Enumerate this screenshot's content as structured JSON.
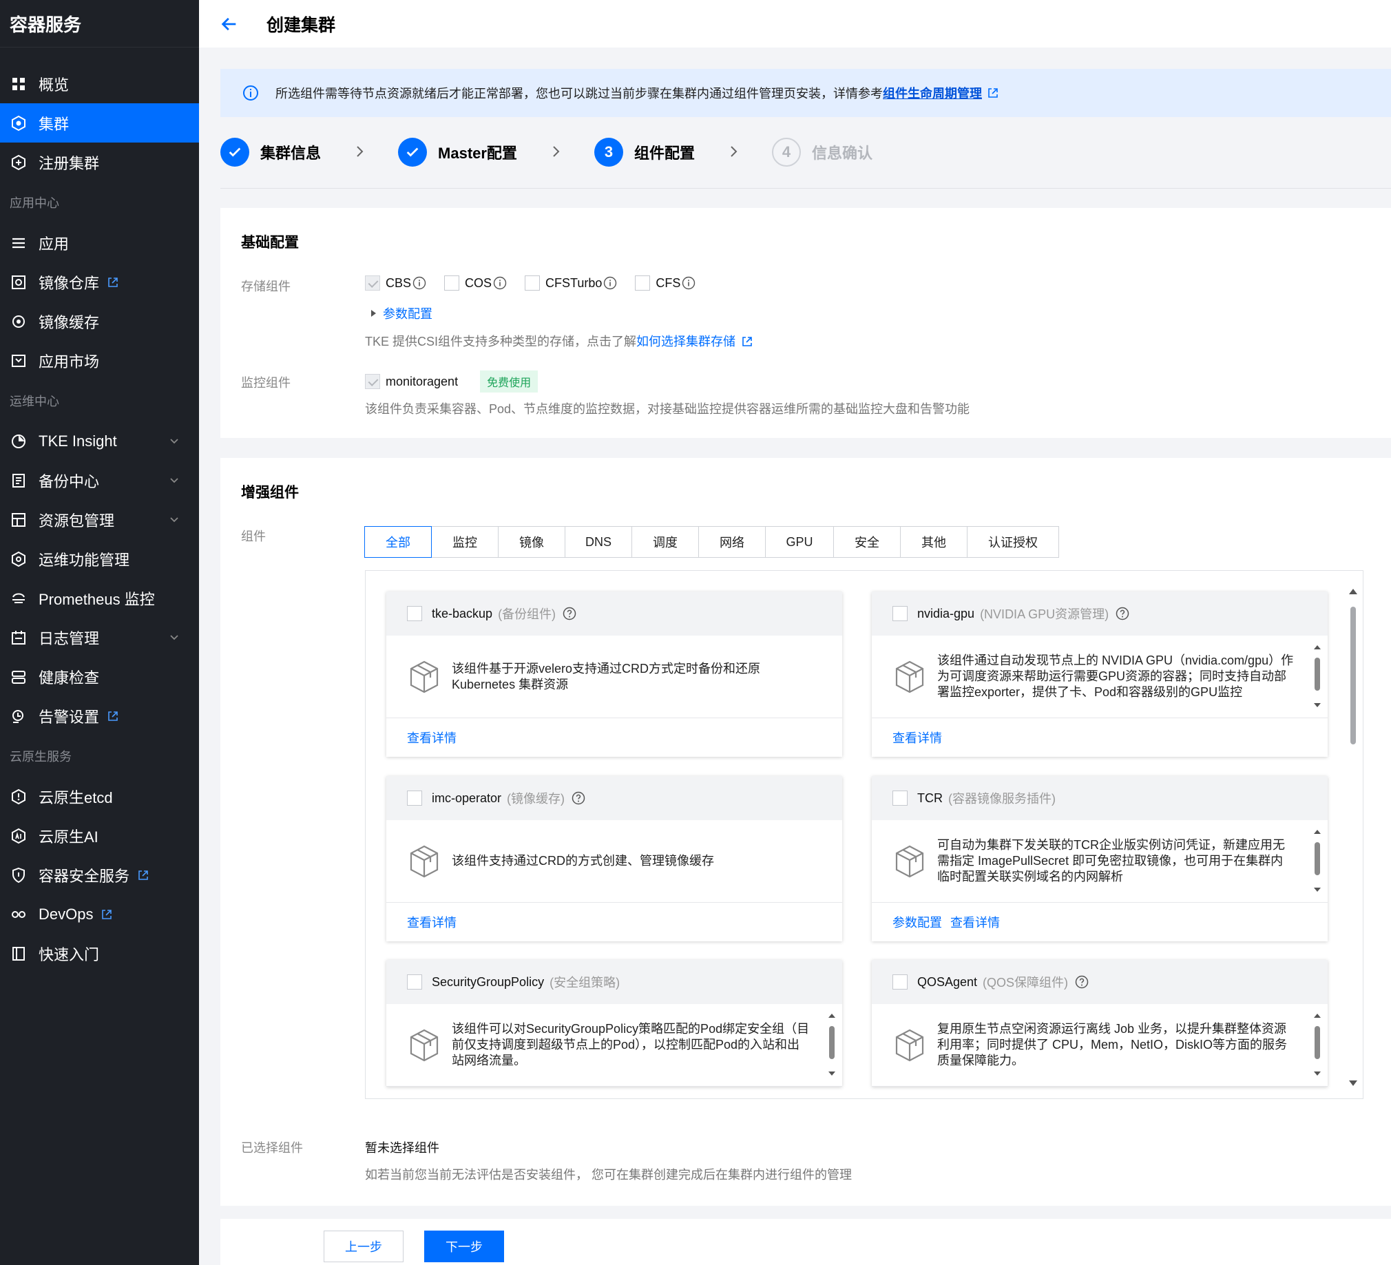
{
  "sidebar": {
    "brand": "容器服务",
    "items_top": [
      {
        "label": "概览",
        "icon": "grid-icon"
      },
      {
        "label": "集群",
        "icon": "cluster-icon",
        "active": true
      },
      {
        "label": "注册集群",
        "icon": "register-icon"
      }
    ],
    "group_app": "应用中心",
    "items_app": [
      {
        "label": "应用",
        "icon": "app-icon"
      },
      {
        "label": "镜像仓库",
        "icon": "image-repo-icon",
        "external": true
      },
      {
        "label": "镜像缓存",
        "icon": "image-cache-icon"
      },
      {
        "label": "应用市场",
        "icon": "market-icon"
      }
    ],
    "group_ops": "运维中心",
    "items_ops": [
      {
        "label": "TKE Insight",
        "icon": "insight-icon",
        "expandable": true
      },
      {
        "label": "备份中心",
        "icon": "backup-icon",
        "expandable": true
      },
      {
        "label": "资源包管理",
        "icon": "package-icon",
        "expandable": true
      },
      {
        "label": "运维功能管理",
        "icon": "ops-icon"
      },
      {
        "label": "Prometheus 监控",
        "icon": "prometheus-icon"
      },
      {
        "label": "日志管理",
        "icon": "log-icon",
        "expandable": true
      },
      {
        "label": "健康检查",
        "icon": "health-icon"
      },
      {
        "label": "告警设置",
        "icon": "alarm-icon",
        "external": true
      }
    ],
    "group_cloud": "云原生服务",
    "items_cloud": [
      {
        "label": "云原生etcd",
        "icon": "etcd-icon"
      },
      {
        "label": "云原生AI",
        "icon": "ai-icon"
      },
      {
        "label": "容器安全服务",
        "icon": "security-icon",
        "external": true
      },
      {
        "label": "DevOps",
        "icon": "devops-icon",
        "external": true
      },
      {
        "label": "快速入门",
        "icon": "quickstart-icon"
      }
    ]
  },
  "header": {
    "title": "创建集群"
  },
  "notice": {
    "text": "所选组件需等待节点资源就绪后才能正常部署，您也可以跳过当前步骤在集群内通过组件管理页安装，详情参考",
    "link": "组件生命周期管理"
  },
  "steps": [
    {
      "label": "集群信息",
      "state": "done"
    },
    {
      "label": "Master配置",
      "state": "done"
    },
    {
      "label": "组件配置",
      "state": "current",
      "num": "3"
    },
    {
      "label": "信息确认",
      "state": "todo",
      "num": "4"
    }
  ],
  "basic": {
    "title": "基础配置",
    "storage_label": "存储组件",
    "storage_options": [
      "CBS",
      "COS",
      "CFSTurbo",
      "CFS"
    ],
    "param_link": "参数配置",
    "storage_desc": "TKE 提供CSI组件支持多种类型的存储，点击了解",
    "storage_desc_link": "如何选择集群存储",
    "monitor_label": "监控组件",
    "monitor_option": "monitoragent",
    "monitor_badge": "免费使用",
    "monitor_desc": "该组件负责采集容器、Pod、节点维度的监控数据，对接基础监控提供容器运维所需的基础监控大盘和告警功能"
  },
  "enhanced": {
    "title": "增强组件",
    "comp_label": "组件",
    "tabs": [
      "全部",
      "监控",
      "镜像",
      "DNS",
      "调度",
      "网络",
      "GPU",
      "安全",
      "其他",
      "认证授权"
    ],
    "components": [
      {
        "name": "tke-backup",
        "cn": "(备份组件)",
        "help": true,
        "desc": "该组件基于开源velero支持通过CRD方式定时备份和还原Kubernetes 集群资源",
        "links": [
          "查看详情"
        ]
      },
      {
        "name": "nvidia-gpu",
        "cn": "(NVIDIA GPU资源管理)",
        "help": true,
        "desc": "该组件通过自动发现节点上的 NVIDIA GPU（nvidia.com/gpu）作为可调度资源来帮助运行需要GPU资源的容器；同时支持自动部署监控exporter，提供了卡、Pod和容器级别的GPU监控",
        "links": [
          "查看详情"
        ]
      },
      {
        "name": "imc-operator",
        "cn": "(镜像缓存)",
        "help": true,
        "desc": "该组件支持通过CRD的方式创建、管理镜像缓存",
        "links": [
          "查看详情"
        ]
      },
      {
        "name": "TCR",
        "cn": "(容器镜像服务插件)",
        "help": false,
        "desc": "可自动为集群下发关联的TCR企业版实例访问凭证，新建应用无需指定 ImagePullSecret 即可免密拉取镜像，也可用于在集群内临时配置关联实例域名的内网解析",
        "links": [
          "参数配置",
          "查看详情"
        ]
      },
      {
        "name": "SecurityGroupPolicy",
        "cn": "(安全组策略)",
        "help": false,
        "desc": "该组件可以对SecurityGroupPolicy策略匹配的Pod绑定安全组（目前仅支持调度到超级节点上的Pod），以控制匹配Pod的入站和出站网络流量。",
        "links": []
      },
      {
        "name": "QOSAgent",
        "cn": "(QOS保障组件)",
        "help": true,
        "desc": "复用原生节点空闲资源运行离线 Job 业务，以提升集群整体资源利用率；同时提供了 CPU，Mem，NetIO，DiskIO等方面的服务质量保障能力。",
        "links": []
      }
    ],
    "selected_label": "已选择组件",
    "selected_value": "暂未选择组件",
    "selected_desc": "如若当前您当前无法评估是否安装组件， 您可在集群创建完成后在集群内进行组件的管理"
  },
  "footer": {
    "prev": "上一步",
    "next": "下一步"
  }
}
